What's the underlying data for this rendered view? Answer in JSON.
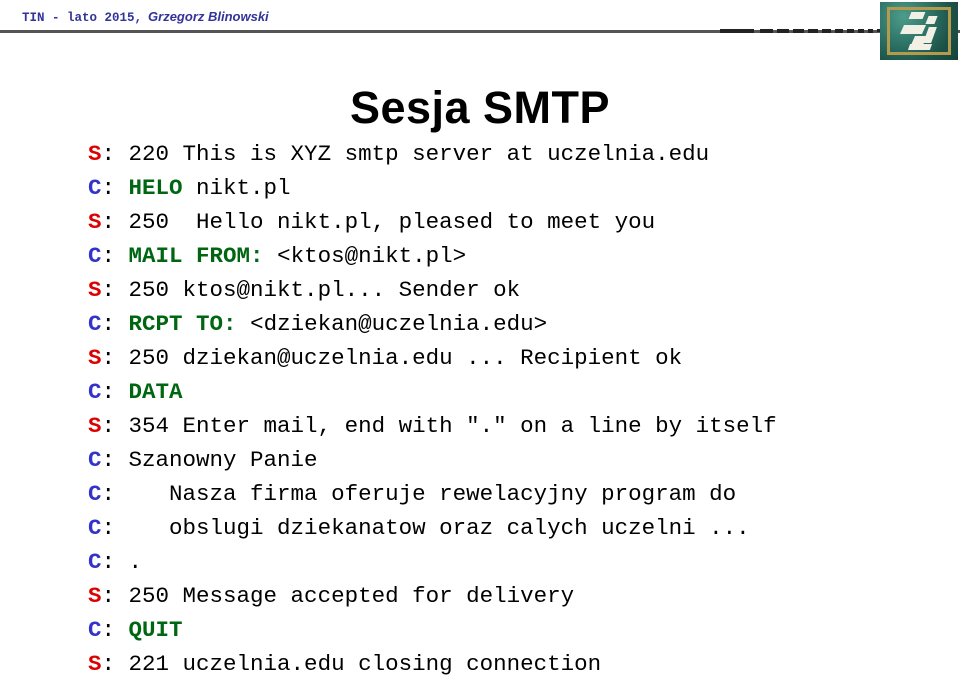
{
  "header": {
    "course": "TIN -  lato 2015,",
    "author": "Grzegorz Blinowski",
    "logo_alt": "institute-logo",
    "rule_color": "#555555",
    "text_color": "#333399"
  },
  "title": "Sesja SMTP",
  "colors": {
    "server_tag": "#dd0000",
    "client_tag": "#3333cc",
    "command": "#006611",
    "body_text": "#000000",
    "background": "#ffffff"
  },
  "legend": {
    "server_prefix": "S",
    "client_prefix": "C",
    "separator": ":"
  },
  "transcript": [
    {
      "side": "S",
      "command": "",
      "text": " 220 This is XYZ smtp server at uczelnia.edu"
    },
    {
      "side": "C",
      "command": " HELO",
      "text": " nikt.pl"
    },
    {
      "side": "S",
      "command": "",
      "text": " 250  Hello nikt.pl, pleased to meet you"
    },
    {
      "side": "C",
      "command": " MAIL FROM:",
      "text": " <ktos@nikt.pl>"
    },
    {
      "side": "S",
      "command": "",
      "text": " 250 ktos@nikt.pl... Sender ok"
    },
    {
      "side": "C",
      "command": " RCPT TO:",
      "text": " <dziekan@uczelnia.edu>"
    },
    {
      "side": "S",
      "command": "",
      "text": " 250 dziekan@uczelnia.edu ... Recipient ok"
    },
    {
      "side": "C",
      "command": " DATA",
      "text": ""
    },
    {
      "side": "S",
      "command": "",
      "text": " 354 Enter mail, end with \".\" on a line by itself"
    },
    {
      "side": "C",
      "command": "",
      "text": " Szanowny Panie"
    },
    {
      "side": "C",
      "command": "",
      "text": "    Nasza firma oferuje rewelacyjny program do"
    },
    {
      "side": "C",
      "command": "",
      "text": "    obslugi dziekanatow oraz calych uczelni ..."
    },
    {
      "side": "C",
      "command": "",
      "text": " ."
    },
    {
      "side": "S",
      "command": "",
      "text": " 250 Message accepted for delivery"
    },
    {
      "side": "C",
      "command": " QUIT",
      "text": ""
    },
    {
      "side": "S",
      "command": "",
      "text": " 221 uczelnia.edu closing connection"
    }
  ]
}
